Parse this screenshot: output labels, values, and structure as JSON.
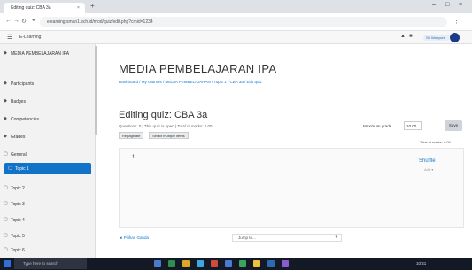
{
  "browser": {
    "tab_title": "Editing quiz: CBA 3a",
    "tab_close": "×",
    "new_tab": "+",
    "window_controls": [
      "–",
      "□",
      "×"
    ],
    "url": "elearning.sman1.sch.id/mod/quiz/edit.php?cmid=1234",
    "nav_back": "←",
    "nav_forward": "→",
    "nav_reload": "↻",
    "lock_icon": "🔒"
  },
  "navbar": {
    "menu_icon": "☰",
    "site_name": "E-Learning",
    "user_name": "Sri Wahyuni"
  },
  "drawer": {
    "items": [
      {
        "icon": "◆",
        "label": "MEDIA PEMBELAJARAN IPA"
      },
      {
        "icon": "◆",
        "label": "Participants"
      },
      {
        "icon": "◆",
        "label": "Badges"
      },
      {
        "icon": "◆",
        "label": "Competencies"
      },
      {
        "icon": "◆",
        "label": "Grades"
      },
      {
        "icon": "▢",
        "label": "General"
      },
      {
        "icon": "▢",
        "label": "Topic 1",
        "active": true
      },
      {
        "icon": "▢",
        "label": "Topic 2"
      },
      {
        "icon": "▢",
        "label": "Topic 3"
      },
      {
        "icon": "▢",
        "label": "Topic 4"
      },
      {
        "icon": "▢",
        "label": "Topic 5"
      },
      {
        "icon": "▢",
        "label": "Topic 6"
      }
    ]
  },
  "main": {
    "course_title": "MEDIA PEMBELAJARAN IPA",
    "breadcrumb": "Dashboard / My courses / MEDIA PEMBELAJARAN / Topic 1 / CBA 3a / Edit quiz",
    "page_title": "Editing quiz: CBA 3a",
    "subtitle": "Questions: 0 | This quiz is open | Total of marks: 0.00",
    "tabs": [
      "Repaginate",
      "Select multiple items"
    ],
    "max_grade_label": "Maximum grade",
    "max_grade_value": "10.00",
    "save_label": "Save",
    "total_marks": "Total of marks: 0.00",
    "page_marker": "1",
    "shuffle_label": "Shuffle",
    "add_label": "Add ▾",
    "bottom_link": "◄ Pilihan Ganda",
    "jump_placeholder": "Jump to...",
    "jump_caret": "▾"
  },
  "taskbar": {
    "search_placeholder": "Type here to search",
    "clock": "10:41"
  },
  "colors": {
    "accent": "#1173c7",
    "link": "#1177d1",
    "taskbar": "#131a25"
  }
}
